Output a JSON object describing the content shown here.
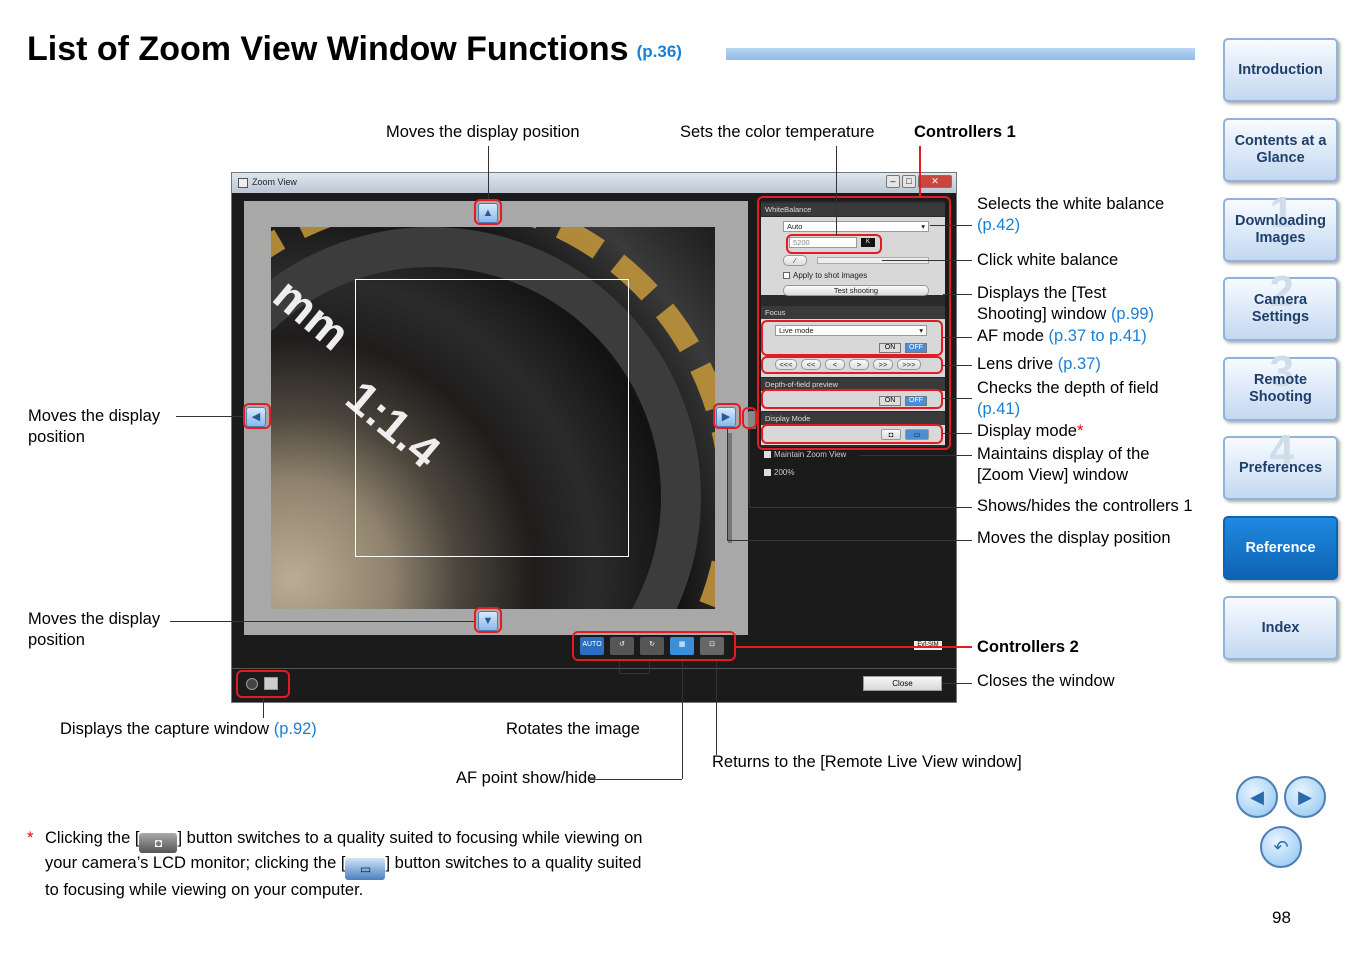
{
  "page": {
    "title": "List of Zoom View Window Functions",
    "title_ref": "(p.36)",
    "page_number": "98"
  },
  "annotations": {
    "moves_top": "Moves the display position",
    "color_temp": "Sets the color temperature",
    "controllers1": "Controllers 1",
    "white_balance": "Selects the white balance",
    "white_balance_ref": "(p.42)",
    "click_wb": "Click white balance",
    "test_shoot_1": "Displays the [Test",
    "test_shoot_2": "Shooting] window",
    "test_shoot_ref": "(p.99)",
    "af_mode": "AF mode",
    "af_mode_ref": "(p.37 to p.41)",
    "lens_drive": "Lens drive",
    "lens_drive_ref": "(p.37)",
    "dof": "Checks the depth of field",
    "dof_ref": "(p.41)",
    "display_mode": "Display mode",
    "display_mode_star": "*",
    "maintain_1": "Maintains display of the",
    "maintain_2": "[Zoom View] window",
    "showhide": "Shows/hides the controllers 1",
    "moves_right": "Moves the display position",
    "moves_left_1": "Moves the display",
    "moves_left_2": "position",
    "moves_bottom_1": "Moves the display",
    "moves_bottom_2": "position",
    "controllers2": "Controllers 2",
    "closes": "Closes the window",
    "capture": "Displays the capture window",
    "capture_ref": "(p.92)",
    "rotates": "Rotates the image",
    "af_point": "AF point show/hide",
    "returns": "Returns to the [Remote Live View window]"
  },
  "window": {
    "title": "Zoom View",
    "wb_section": "WhiteBalance",
    "wb_value": "Auto",
    "kelvin": "5200",
    "kelvin_unit": "K",
    "apply_shot": "Apply to shot images",
    "test_shooting": "Test shooting",
    "focus_section": "Focus",
    "live_mode": "Live mode",
    "on": "ON",
    "off": "OFF",
    "lens_buttons": [
      "<<<",
      "<<",
      "<",
      ">",
      ">>",
      ">>>"
    ],
    "dof_section": "Depth-of-field preview",
    "display_section": "Display Mode",
    "maintain": "Maintain Zoom View",
    "pct200": "200%",
    "auto": "AUTO",
    "close": "Close",
    "evf": "Evf-SIM",
    "photo_text1": "mm",
    "photo_text2": "1:1.4"
  },
  "sidebar": {
    "items": [
      "Introduction",
      "Contents at a Glance",
      "Downloading Images",
      "Camera Settings",
      "Remote Shooting",
      "Preferences",
      "Reference",
      "Index"
    ],
    "numbers": [
      "1",
      "2",
      "3",
      "4"
    ]
  },
  "footnote": {
    "star": "*",
    "part1": "Clicking the [",
    "part2": "] button switches to a quality suited to focusing while viewing on your camera’s LCD monitor; clicking the [",
    "part3": "] button switches to a quality suited to focusing while viewing on your computer."
  }
}
